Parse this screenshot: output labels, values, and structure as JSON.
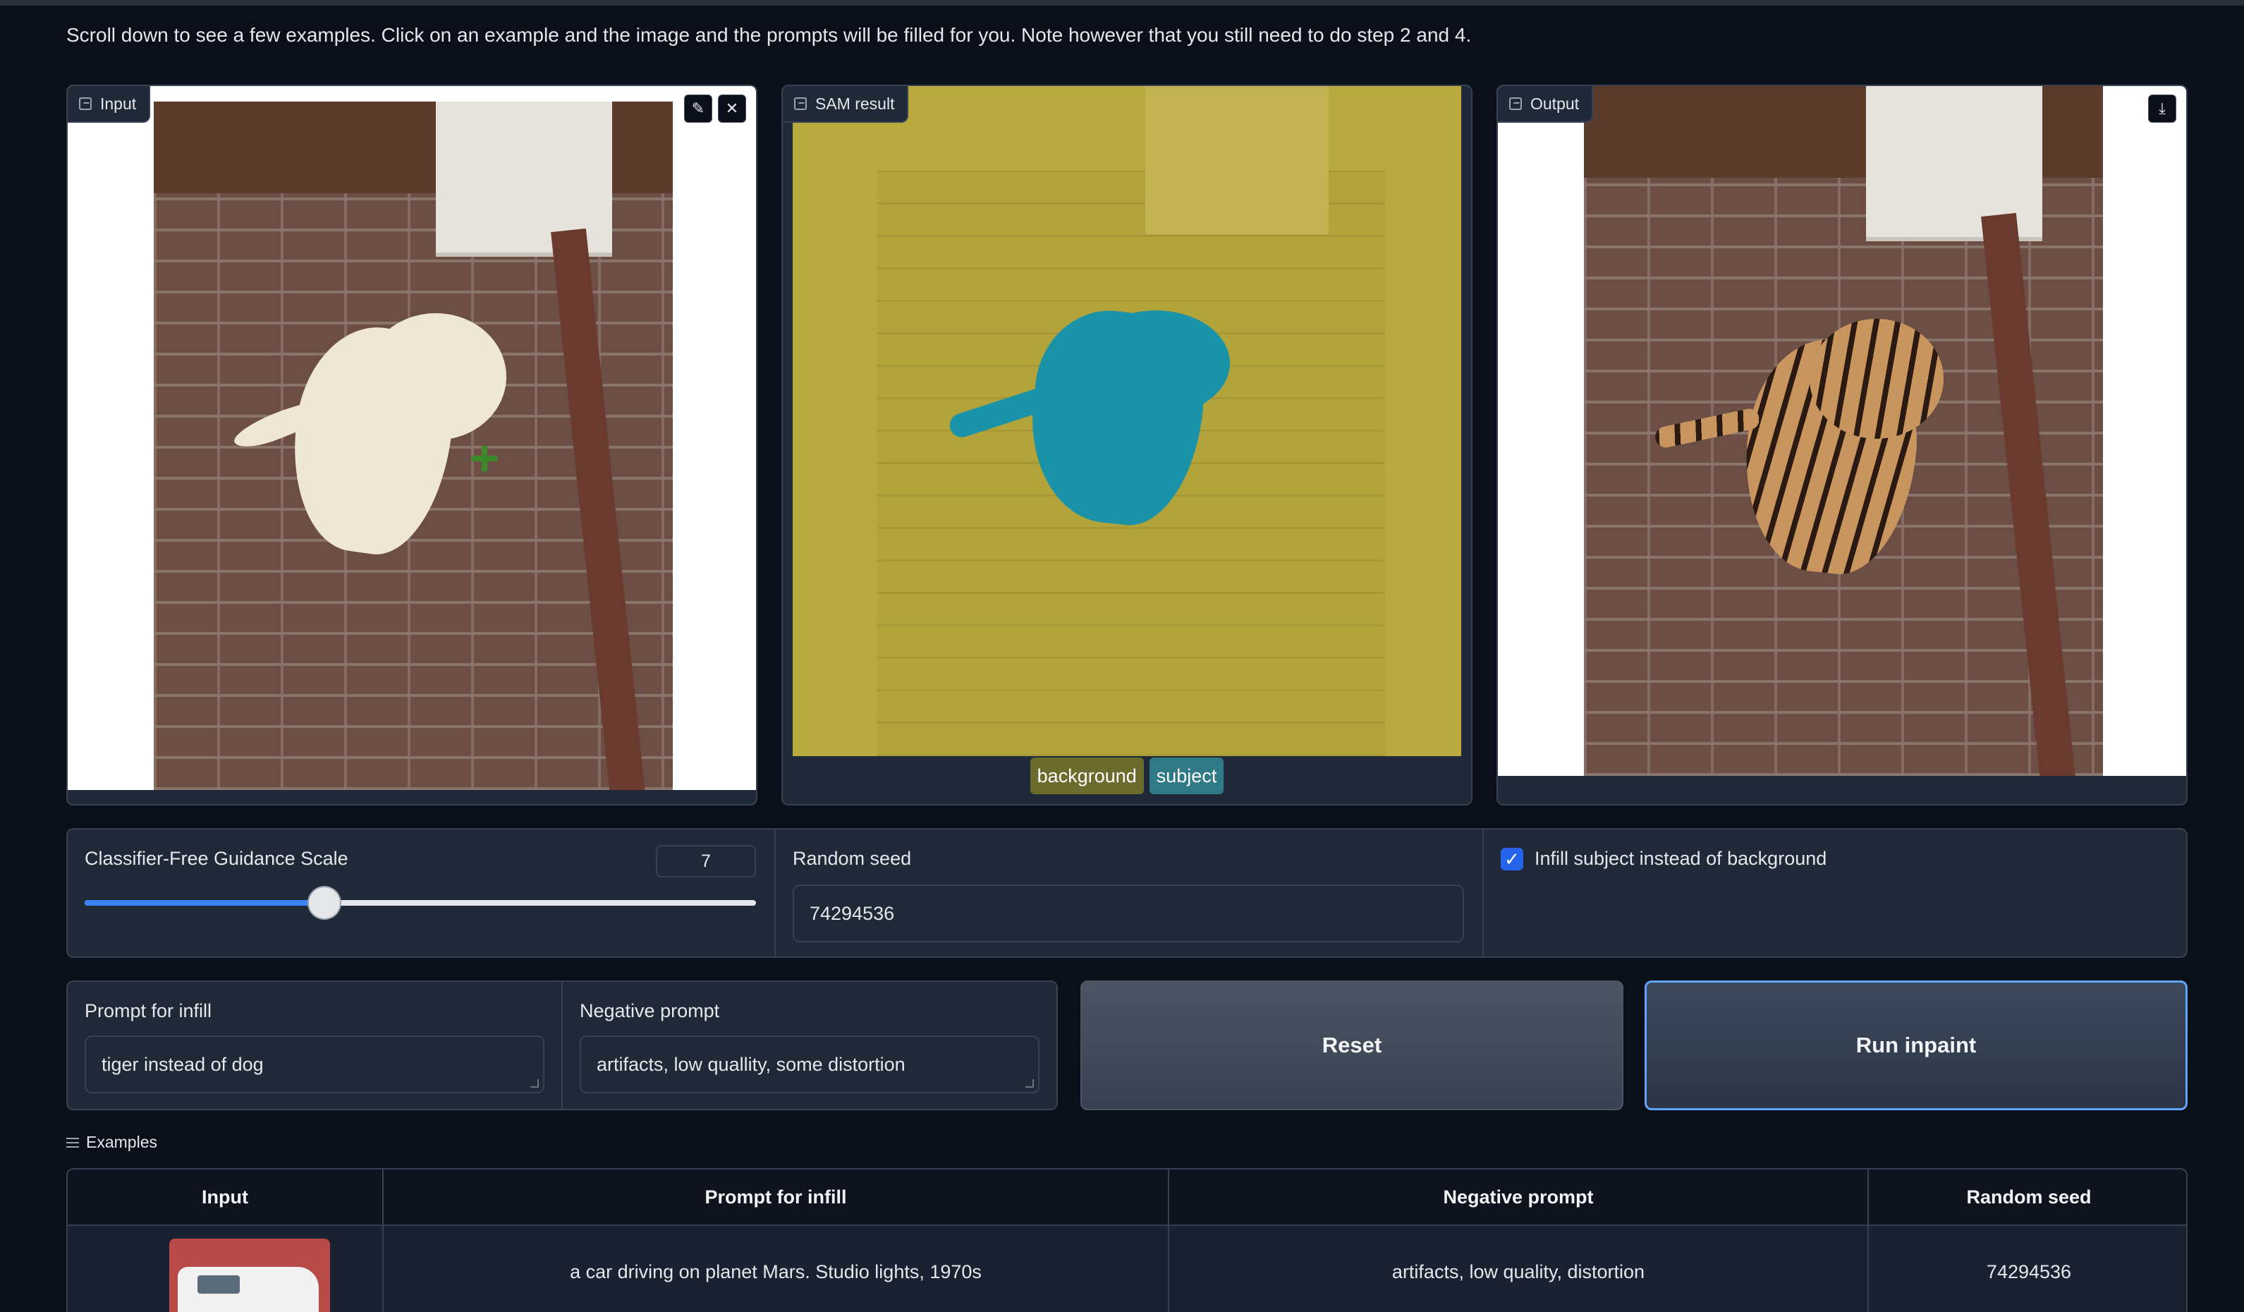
{
  "intro_text": "Scroll down to see a few examples. Click on an example and the image and the prompts will be filled for you. Note however that you still need to do step 2 and 4.",
  "panels": {
    "input": {
      "label": "Input",
      "icon": "image-icon"
    },
    "sam": {
      "label": "SAM result",
      "icon": "image-icon",
      "legend": [
        {
          "label": "background",
          "color": "#6b6b2e"
        },
        {
          "label": "subject",
          "color": "#2f7a86"
        }
      ]
    },
    "output": {
      "label": "Output",
      "icon": "image-icon"
    }
  },
  "controls": {
    "cfg_label": "Classifier-Free Guidance Scale",
    "cfg_value": "7",
    "cfg_fraction": 0.357,
    "seed_label": "Random seed",
    "seed_value": "74294536",
    "infill_checkbox_label": "Infill subject instead of background",
    "infill_checked": true
  },
  "prompts": {
    "infill_label": "Prompt for infill",
    "infill_value": "tiger instead of dog",
    "negative_label": "Negative prompt",
    "negative_value": "artifacts, low quallity, some distortion"
  },
  "buttons": {
    "reset": "Reset",
    "run": "Run inpaint"
  },
  "examples": {
    "title": "Examples",
    "headers": [
      "Input",
      "Prompt for infill",
      "Negative prompt",
      "Random seed"
    ],
    "rows": [
      {
        "prompt": "a car driving on planet Mars. Studio lights, 1970s",
        "negative": "artifacts, low quality, distortion",
        "seed": "74294536"
      }
    ]
  },
  "colors": {
    "background": "#0b0f19",
    "panel": "#1f2937",
    "accent": "#3b82f6",
    "sam_background": "#b8a93e",
    "sam_subject": "#1a93a8"
  }
}
